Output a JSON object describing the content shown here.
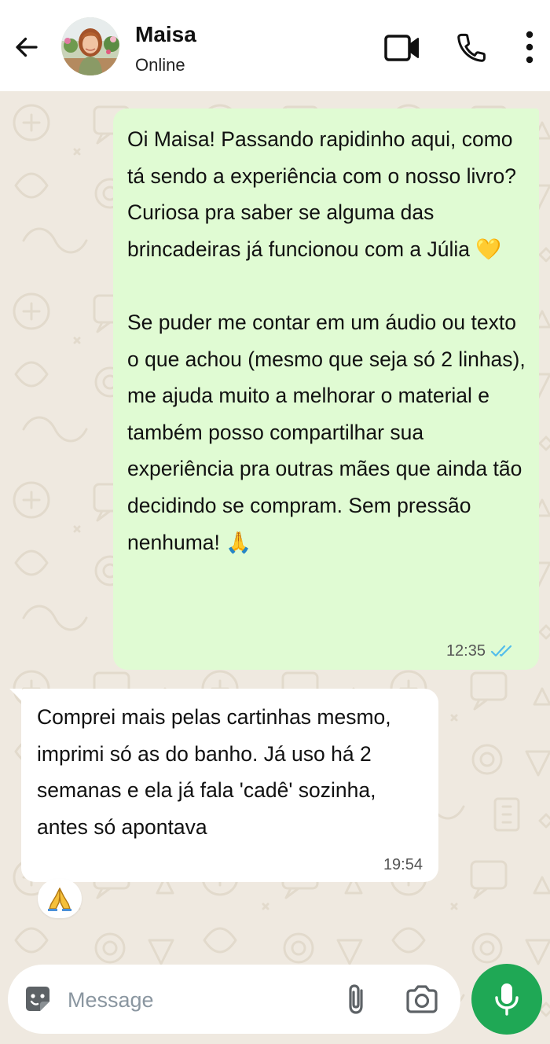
{
  "header": {
    "contact_name": "Maisa",
    "status": "Online",
    "icons": {
      "back": "arrow-left-icon",
      "avatar": "contact-avatar",
      "video": "video-camera-icon",
      "call": "phone-icon",
      "menu": "more-vertical-icon"
    }
  },
  "messages": [
    {
      "direction": "outgoing",
      "text": "Oi Maisa! Passando rapidinho aqui, como tá sendo a experiência com o nosso livro? Curiosa pra saber se alguma das brincadeiras já funcionou com a Júlia 💛\n\nSe puder me contar em um áudio ou texto o que achou (mesmo que seja só 2 linhas), me ajuda muito a melhorar o material e também posso compartilhar sua experiência pra outras mães que ainda tão decidindo se compram. Sem pressão nenhuma! 🙏",
      "time": "12:35",
      "status": "read",
      "status_icon": "double-check-icon"
    },
    {
      "direction": "incoming",
      "text": "Comprei mais pelas cartinhas mesmo, imprimi só as do banho. Já uso há 2 semanas e ela já fala 'cadê' sozinha, antes só apontava",
      "time": "19:54",
      "reaction": "🙏"
    }
  ],
  "composer": {
    "placeholder": "Message",
    "value": "",
    "icons": {
      "sticker": "sticker-icon",
      "attach": "paperclip-icon",
      "camera": "camera-icon",
      "mic": "microphone-icon"
    }
  },
  "colors": {
    "outgoing_bubble": "#e0fbd3",
    "incoming_bubble": "#ffffff",
    "chat_background": "#efe9e0",
    "mic_button": "#1fa855",
    "read_ticks": "#53bdeb"
  }
}
